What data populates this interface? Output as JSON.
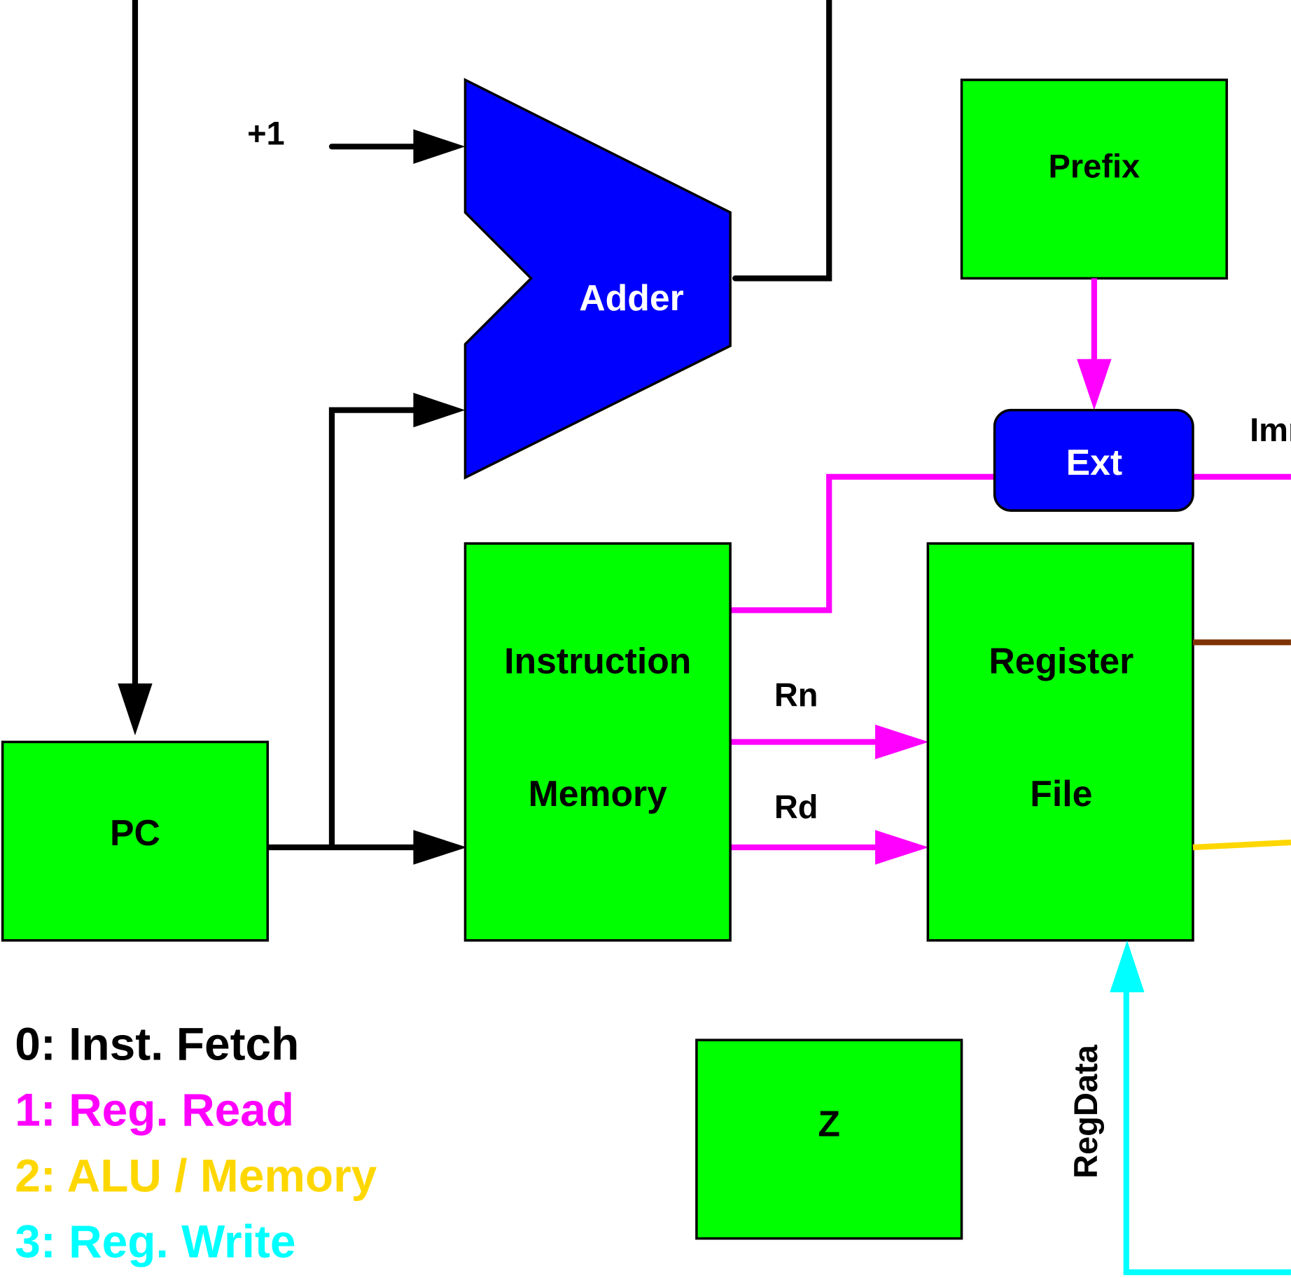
{
  "colors": {
    "block_fill": "#00ff00",
    "unit_fill": "#0000ff",
    "stage0": "#000000",
    "stage1": "#ff00ff",
    "stage2": "#ffd700",
    "stage3": "#00ffff",
    "brown_wire": "#7f3300"
  },
  "blocks": {
    "adder": "Adder",
    "prefix": "Prefix",
    "ext": "Ext",
    "instruction_memory": [
      "Instruction",
      "Memory"
    ],
    "register_file": [
      "Register",
      "File"
    ],
    "pc": "PC",
    "z": "Z"
  },
  "signals": {
    "plus_one": "+1",
    "imm": "Imm",
    "rn": "Rn",
    "rd": "Rd",
    "regdata": "RegData"
  },
  "legend": [
    {
      "label": "0: Inst. Fetch"
    },
    {
      "label": "1: Reg. Read"
    },
    {
      "label": "2: ALU / Memory"
    },
    {
      "label": "3: Reg. Write"
    }
  ]
}
